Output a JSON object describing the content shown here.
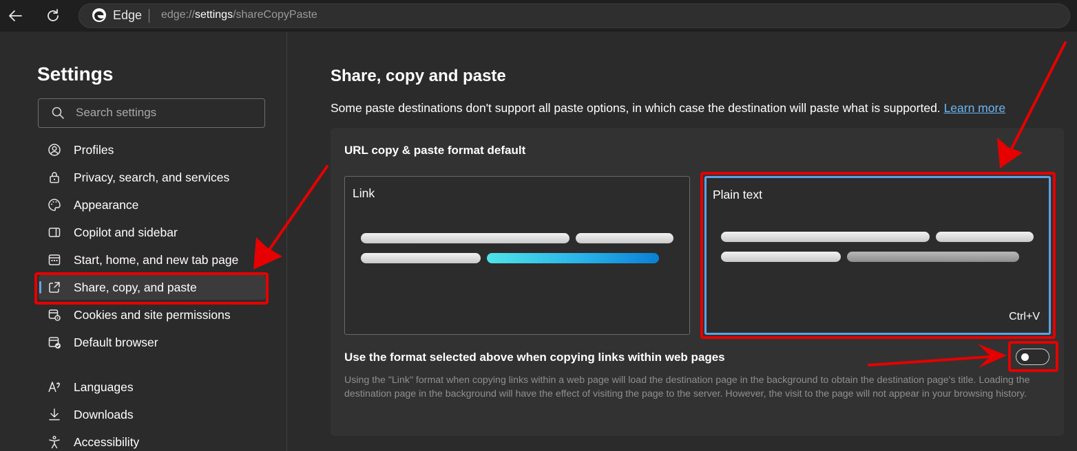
{
  "browser": {
    "brand_label": "Edge",
    "url_scheme": "edge://",
    "url_host": "settings",
    "url_path": "/shareCopyPaste"
  },
  "sidebar": {
    "title": "Settings",
    "search_placeholder": "Search settings",
    "items": [
      {
        "label": "Profiles",
        "icon": "profile-icon"
      },
      {
        "label": "Privacy, search, and services",
        "icon": "lock-icon"
      },
      {
        "label": "Appearance",
        "icon": "palette-icon"
      },
      {
        "label": "Copilot and sidebar",
        "icon": "sidebar-panel-icon"
      },
      {
        "label": "Start, home, and new tab page",
        "icon": "new-tab-page-icon"
      },
      {
        "label": "Share, copy, and paste",
        "icon": "share-icon",
        "active": true
      },
      {
        "label": "Cookies and site permissions",
        "icon": "site-permissions-icon"
      },
      {
        "label": "Default browser",
        "icon": "default-browser-icon"
      },
      {
        "label": "Languages",
        "icon": "languages-icon"
      },
      {
        "label": "Downloads",
        "icon": "download-icon"
      },
      {
        "label": "Accessibility",
        "icon": "accessibility-icon"
      }
    ]
  },
  "main": {
    "title": "Share, copy and paste",
    "description": "Some paste destinations don't support all paste options, in which case the destination will paste what is supported.",
    "learn_more": "Learn more",
    "card": {
      "heading": "URL copy & paste format default",
      "options": [
        {
          "label": "Link",
          "selected": false
        },
        {
          "label": "Plain text",
          "selected": true,
          "shortcut": "Ctrl+V"
        }
      ],
      "toggle_label": "Use the format selected above when copying links within web pages",
      "toggle_on": false,
      "help_text": "Using the \"Link\" format when copying links within a web page will load the destination page in the background to obtain the destination page's title. Loading the destination page in the background will have the effect of visiting the page to the server. However, the visit to the page will not appear in your browsing history."
    }
  },
  "colors": {
    "accent": "#5aa3e5",
    "annotation": "#e60000",
    "link": "#6bb6f5"
  }
}
